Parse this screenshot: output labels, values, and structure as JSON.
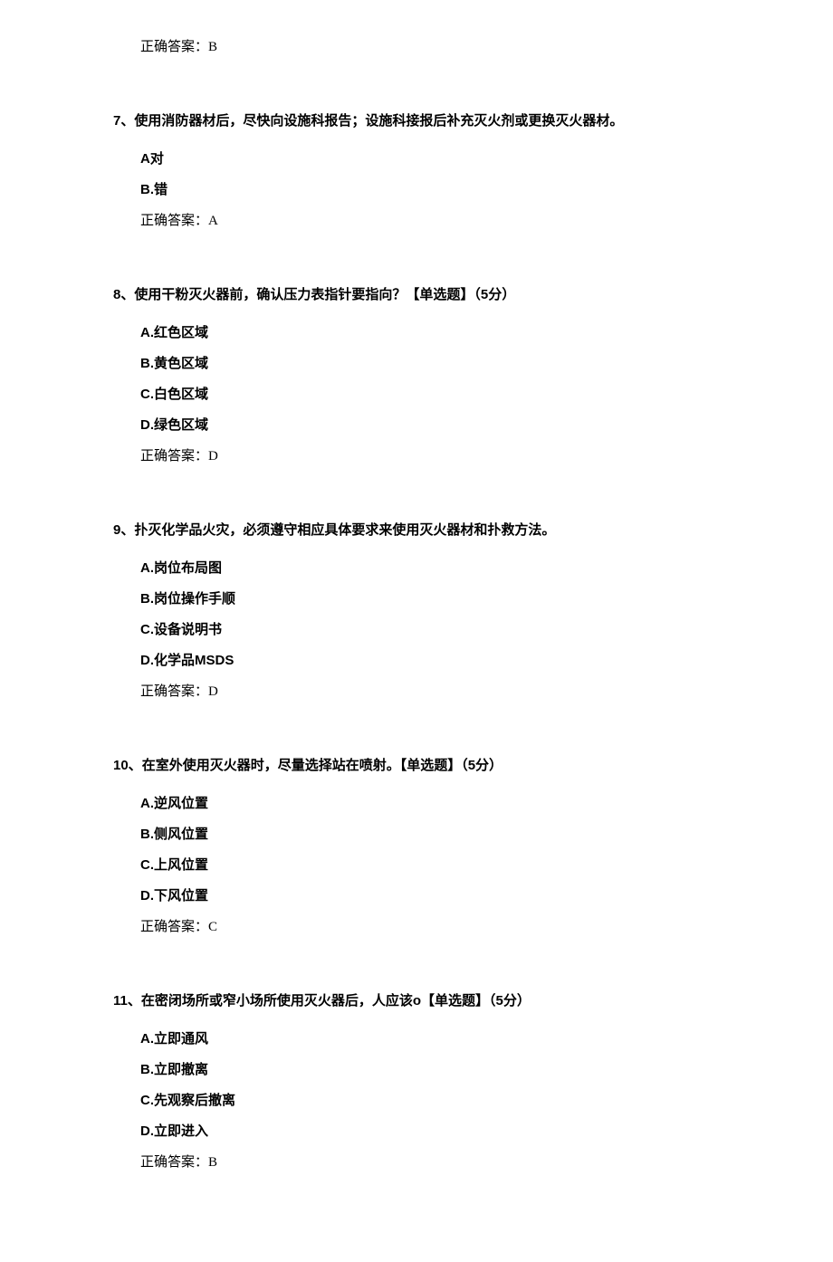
{
  "q6": {
    "answer_label": "正确答案：",
    "answer": "B"
  },
  "q7": {
    "number": "7、",
    "text": "使用消防器材后，尽快向设施科报告；设施科接报后补充灭火剂或更换灭火器材。",
    "options": {
      "a": "A对",
      "b": "B.错"
    },
    "answer_label": "正确答案：",
    "answer": "A"
  },
  "q8": {
    "number": "8、",
    "text": "使用干粉灭火器前，确认压力表指针要指向？【单选题】（5分）",
    "options": {
      "a": "A.红色区域",
      "b": "B.黄色区域",
      "c": "C.白色区域",
      "d": "D.绿色区域"
    },
    "answer_label": "正确答案：",
    "answer": "D"
  },
  "q9": {
    "number": "9、",
    "text": "扑灭化学品火灾，必须遵守相应具体要求来使用灭火器材和扑救方法。",
    "options": {
      "a": "A.岗位布局图",
      "b": "B.岗位操作手顺",
      "c": "C.设备说明书",
      "d": "D.化学品MSDS"
    },
    "answer_label": "正确答案：",
    "answer": "D"
  },
  "q10": {
    "number": "10、",
    "text": "在室外使用灭火器时，尽量选择站在喷射。【单选题】（5分）",
    "options": {
      "a": "A.逆风位置",
      "b": "B.侧风位置",
      "c": "C.上风位置",
      "d": "D.下风位置"
    },
    "answer_label": "正确答案：",
    "answer": "C"
  },
  "q11": {
    "number": "11、",
    "text": "在密闭场所或窄小场所使用灭火器后，人应该o【单选题】（5分）",
    "options": {
      "a": "A.立即通风",
      "b": "B.立即撤离",
      "c": "C.先观察后撤离",
      "d": "D.立即进入"
    },
    "answer_label": "正确答案：",
    "answer": "B"
  }
}
